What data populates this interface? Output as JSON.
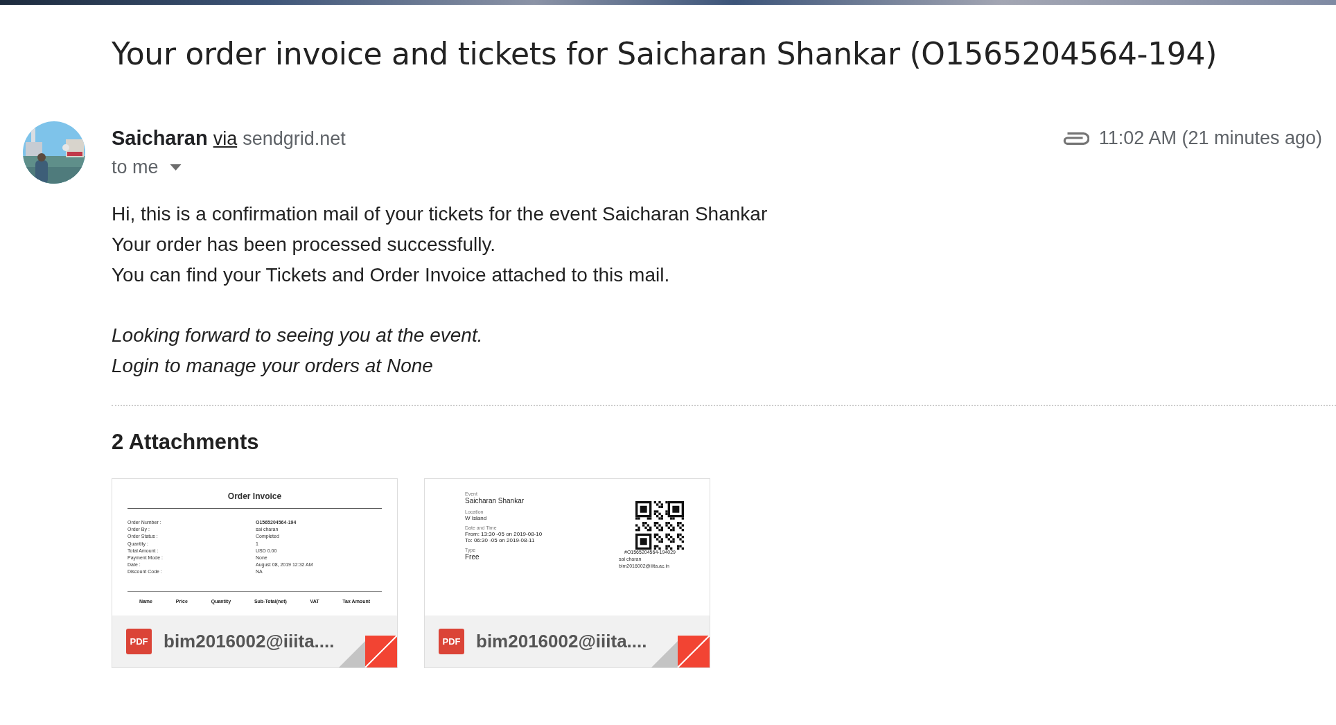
{
  "subject": "Your order invoice and tickets for Saicharan Shankar (O1565204564-194)",
  "sender": {
    "name": "Saicharan",
    "via": "via",
    "domain": "sendgrid.net",
    "recipient": "to me",
    "time": "11:02 AM (21 minutes ago)"
  },
  "body": {
    "lines": [
      "Hi, this is a confirmation mail of your tickets for the event Saicharan Shankar",
      "Your order has been processed successfully.",
      "You can find your Tickets and Order Invoice attached to this mail."
    ],
    "closing": [
      "Looking forward to seeing you at the event.",
      "Login to manage your orders at None"
    ]
  },
  "attachments": {
    "heading": "2 Attachments",
    "items": [
      {
        "kind": "invoice",
        "file_type": "PDF",
        "filename": "bim2016002@iiita....",
        "preview": {
          "title": "Order Invoice",
          "fields": [
            {
              "label": "Order Number :",
              "value": "O1565204564-194"
            },
            {
              "label": "Order By :",
              "value": "sai charan"
            },
            {
              "label": "Order Status :",
              "value": "Completed"
            },
            {
              "label": "Quantity :",
              "value": "1"
            },
            {
              "label": "Total Amount :",
              "value": "USD 0.00"
            },
            {
              "label": "Payment Mode :",
              "value": "None"
            },
            {
              "label": "Date :",
              "value": "August 08, 2019 12:32 AM"
            },
            {
              "label": "Discount Code :",
              "value": "NA"
            }
          ],
          "columns": [
            "Name",
            "Price",
            "Quantity",
            "Sub-Total(net)",
            "VAT",
            "Tax Amount"
          ]
        }
      },
      {
        "kind": "ticket",
        "file_type": "PDF",
        "filename": "bim2016002@iiita....",
        "preview": {
          "fields": [
            {
              "label": "Event",
              "lines": [
                "Saicharan Shankar"
              ]
            },
            {
              "label": "Location",
              "lines": [
                "W Island"
              ]
            },
            {
              "label": "Date and Time",
              "lines": [
                "From: 13:30 -05 on 2019-08-10",
                "To: 06:30 -05 on 2019-08-11"
              ]
            },
            {
              "label": "Type",
              "lines": [
                "Free"
              ]
            }
          ],
          "code": "#O1565204564-194029",
          "holder": "sai charan",
          "email": "bim2016002@iiita.ac.in"
        }
      }
    ]
  }
}
